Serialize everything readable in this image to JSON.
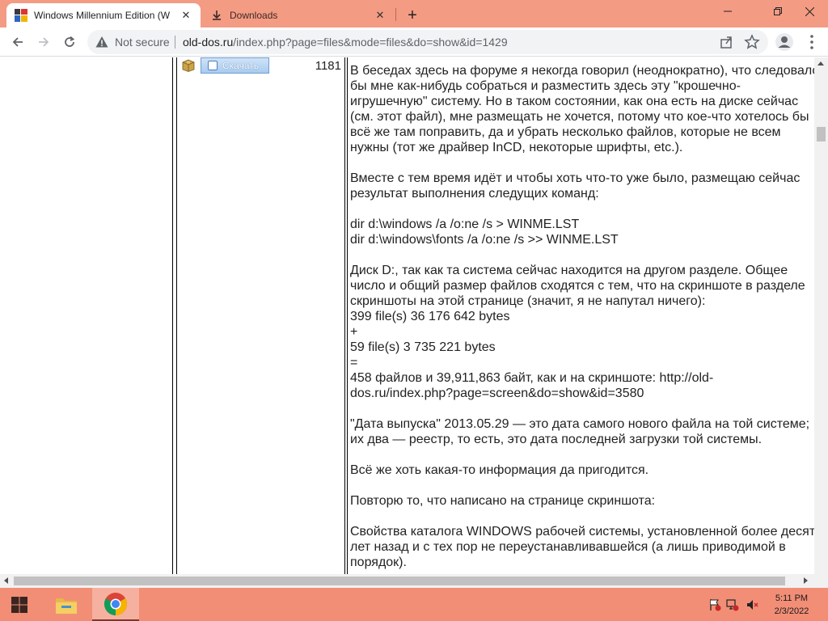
{
  "browser": {
    "tabs": [
      {
        "title": "Windows Millennium Edition (W",
        "favicon": "ms-logo-favicon"
      },
      {
        "title": "Downloads",
        "favicon": "download-icon"
      }
    ],
    "window_controls": {
      "minimize": "minimize-icon",
      "restore": "restore-icon",
      "close": "close-icon"
    },
    "omnibox": {
      "security_label": "Not secure",
      "host": "old-dos.ru",
      "path": "/index.php?page=files&mode=files&do=show&id=1429"
    }
  },
  "page": {
    "download_button": "Скачать",
    "download_count": "1181",
    "description": "В беседах здесь на форуме я некогда говорил (неоднократно), что следовало\nбы мне как-нибудь собраться и разместить здесь эту \"крошечно-\nигрушечную\" систему. Но в таком состоянии, как она есть на диске сейчас\n(см. этот файл), мне размещать не хочется, потому что кое-что хотелось бы\nвсё же там поправить, да и убрать несколько файлов, которые не всем\nнужны (тот же драйвер InCD, некоторые шрифты, etc.).\n\nВместе с тем время идёт и чтобы хоть что-то уже было, размещаю сейчас\nрезультат выполнения следущих команд:\n\ndir d:\\windows /a /o:ne /s > WINME.LST\ndir d:\\windows\\fonts /a /o:ne /s >> WINME.LST\n\nДиск D:, так как та система сейчас находится на другом разделе. Общее\nчисло и общий размер файлов сходятся с тем, что на скриншоте в разделе\nскриншоты на этой странице (значит, я не напутал ничего):\n399 file(s) 36 176 642 bytes\n+\n59 file(s) 3 735 221 bytes\n=\n458 файлов и 39,911,863 байт, как и на скриншоте: http://old-\ndos.ru/index.php?page=screen&do=show&id=3580\n\n\"Дата выпуска\" 2013.05.29 — это дата самого нового файла на той системе;\nих два — реестр, то есть, это дата последней загрузки той системы.\n\nВсё же хоть какая-то информация да пригодится.\n\nПовторю то, что написано на странице скриншота:\n\nСвойства каталога WINDOWS рабочей системы, установленной более десяти\nлет назад и с тех пор не переустанавливавшейся (а лишь приводимой в\nпорядок)."
  },
  "taskbar": {
    "items": [
      "start-button",
      "file-explorer-icon",
      "chrome-icon"
    ],
    "tray": [
      "flag-icon",
      "network-icon",
      "volume-muted-icon"
    ],
    "time": "5:11 PM",
    "date": "2/3/2022"
  },
  "colors": {
    "tabstrip": "#f49b84",
    "taskbar": "#f28e76",
    "accent_button": "#a9cbee"
  }
}
